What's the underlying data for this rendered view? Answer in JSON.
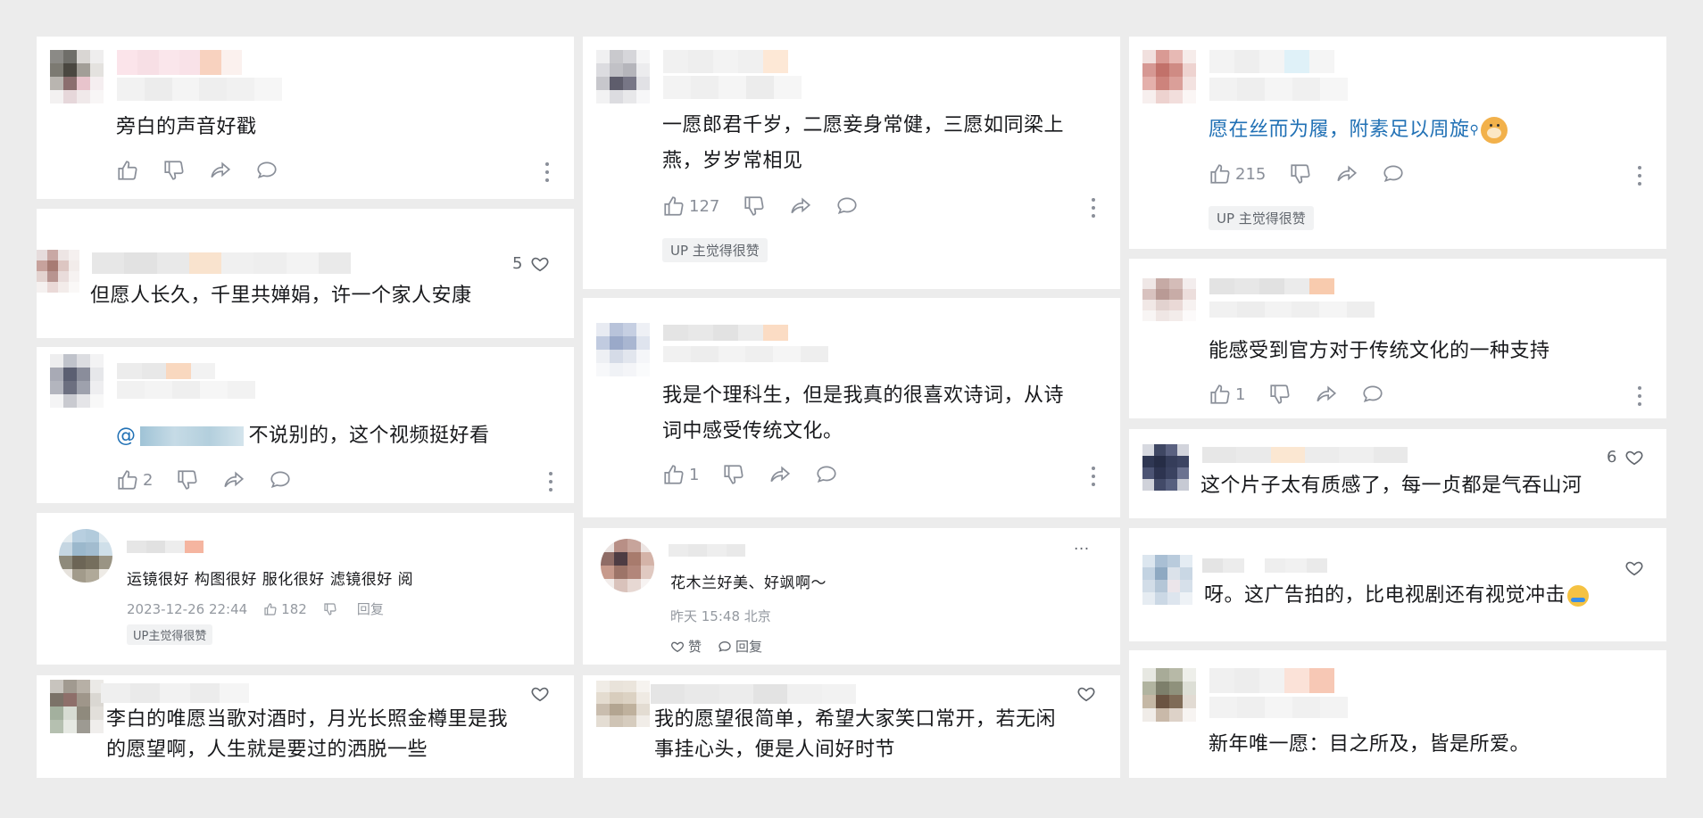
{
  "icons": {
    "like": "thumb-up-icon",
    "dislike": "thumb-down-icon",
    "share": "share-icon",
    "reply": "comment-icon",
    "more": "more-vertical-icon",
    "heart": "heart-icon"
  },
  "colors": {
    "background": "#ececec",
    "card": "#ffffff",
    "link_blue": "#2171b5",
    "muted": "#9499a0"
  },
  "columns": [
    {
      "cards": [
        {
          "text": "旁白的声音好戳"
        },
        {
          "text": "但愿人长久，千里共婵娟，许一个家人安康",
          "like_count": "5"
        },
        {
          "mention_prefix": "@",
          "text": "不说别的，这个视频挺好看",
          "like_count": "2"
        },
        {
          "text": "运镜很好 构图很好 服化很好 滤镜很好    阅",
          "time": "2023-12-26 22:44",
          "like_count": "182",
          "reply_label": "回复",
          "badge": "UP主觉得很赞"
        },
        {
          "text_line1": "李白的唯愿当歌对酒时，月光长照金樽里是我",
          "text_line2": "的愿望啊，人生就是要过的洒脱一些"
        }
      ]
    },
    {
      "cards": [
        {
          "text_line1": "一愿郎君千岁，二愿妾身常健，三愿如同梁上",
          "text_line2": "燕，岁岁常相见",
          "like_count": "127",
          "badge": "UP 主觉得很赞"
        },
        {
          "text_line1": "我是个理科生，但是我真的很喜欢诗词，从诗",
          "text_line2": "词中感受传统文化。",
          "like_count": "1"
        },
        {
          "text": "花木兰好美、好飒啊～",
          "time": "昨天 15:48 北京",
          "like_label": "赞",
          "reply_label": "回复",
          "more": "···"
        },
        {
          "text_line1": "我的愿望很简单，希望大家笑口常开，若无闲",
          "text_line2": "事挂心头，便是人间好时节"
        }
      ]
    },
    {
      "cards": [
        {
          "text": "愿在丝而为履，附素足以周旋",
          "like_count": "215",
          "badge": "UP 主觉得很赞"
        },
        {
          "text": "能感受到官方对于传统文化的一种支持",
          "like_count": "1"
        },
        {
          "text": "这个片子太有质感了，每一贞都是气吞山河",
          "like_count": "6"
        },
        {
          "text": "呀。这广告拍的，比电视剧还有视觉冲击"
        },
        {
          "text": "新年唯一愿：目之所及，皆是所爱。"
        }
      ]
    }
  ]
}
